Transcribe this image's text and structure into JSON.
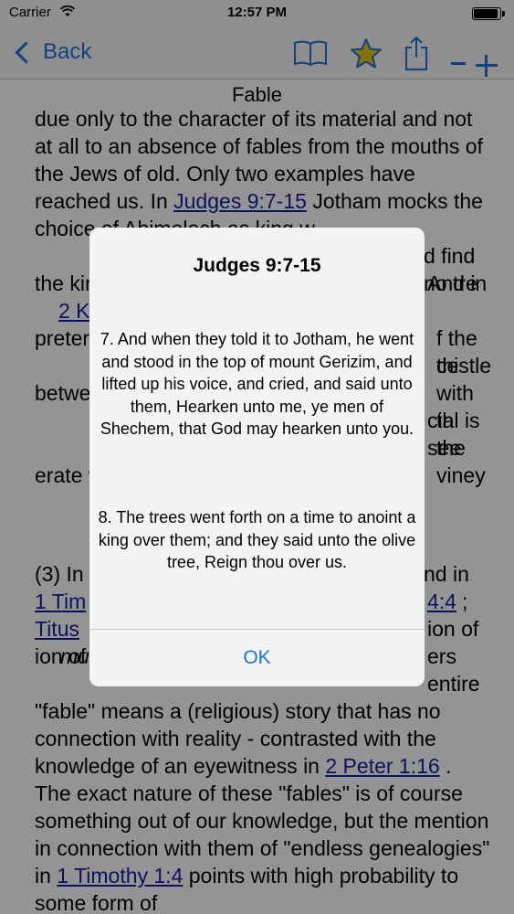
{
  "status_bar": {
    "carrier": "Carrier",
    "time": "12:57 PM"
  },
  "navbar": {
    "back_label": "Back",
    "icons": [
      "book-icon",
      "star-icon",
      "share-icon",
      "minus-icon",
      "plus-icon"
    ],
    "accent_color": "#1a73d9"
  },
  "page": {
    "title": "Fable",
    "para1": {
      "t1": "due only to the character of its material and not at all to an absence of fables from the mouths of the Jews of old. Only two examples have reached us. In ",
      "link1": "Judges 9:7-15",
      "t2": " Jotham mocks the choice of Abimelech as king w",
      "t3": "d find no tre",
      "t4": "the kingsh",
      "t5": "And in ",
      "link2": "2 K",
      "t6": "preter",
      "t7": "f the thistle",
      "t8": "ce with th",
      "t9": "betwe",
      "t10": "cial is see",
      "t11": "the viney",
      "t12": "erate will to"
    },
    "para2": {
      "t1": "(3) In",
      "t2": "nd in ",
      "link1": "1 Tim",
      "link2": "4:4",
      "t3": "; ",
      "link3": "Titus",
      "t4": "ion of ",
      "em1": "mu",
      "t5": "ers entire",
      "t6": "\"fable\" means a (religious) story that has no connection with reality - contrasted with the knowledge of an eyewitness in ",
      "link4": "2 Peter 1:16",
      "t7": " . The exact nature of these \"fables\" is of course something out of our knowledge, but the mention in connection with them of \"endless genealogies\" in ",
      "link5": "1 Timothy 1:4",
      "t8": " points with high probability to some form of"
    }
  },
  "alert": {
    "title": "Judges 9:7-15",
    "verse7": "7. And when they told it to Jotham, he went and stood in the top of mount Gerizim, and lifted up his voice, and cried, and said unto them, Hearken unto me, ye men of Shechem, that God may hearken unto you.",
    "verse8": "8. The trees went forth on a time to anoint a king over them; and they said unto the olive tree, Reign thou over us.",
    "ok_label": "OK"
  }
}
